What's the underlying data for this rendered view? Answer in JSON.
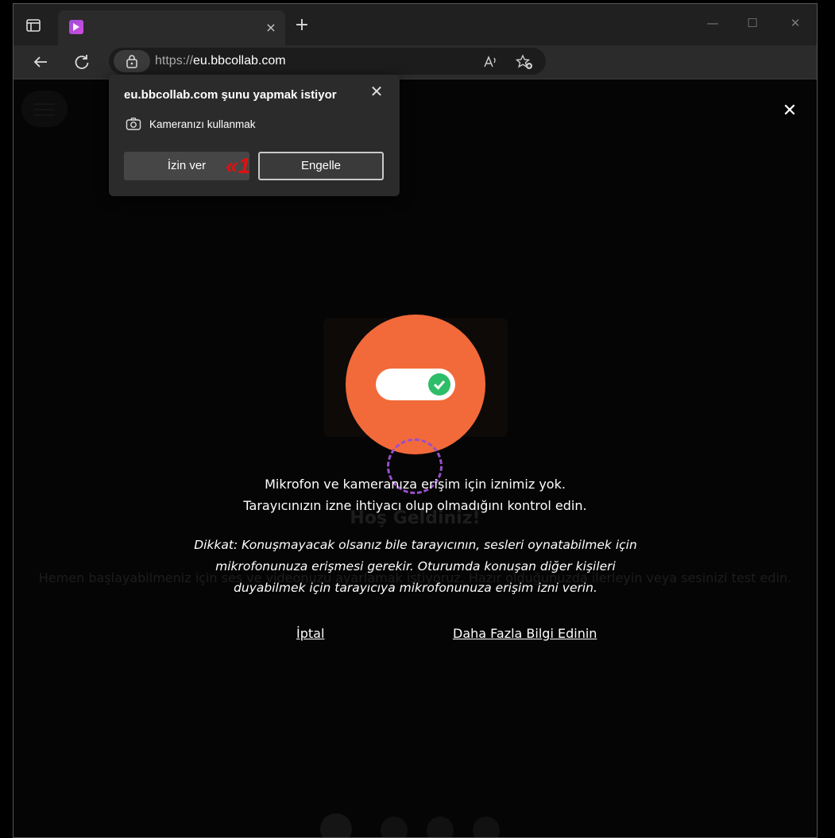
{
  "browser": {
    "url_scheme": "https://",
    "url_host": "eu.bbcollab.com",
    "new_tab_symbol": "+",
    "tab_close_symbol": "×",
    "minimize_symbol": "—",
    "maximize_symbol": "☐",
    "close_symbol": "✕"
  },
  "permission_popup": {
    "title": "eu.bbcollab.com şunu yapmak istiyor",
    "permission_label": "Kameranızı kullanmak",
    "allow_label": "İzin ver",
    "block_label": "Engelle",
    "close_symbol": "✕",
    "annotation_marker": "«1"
  },
  "page": {
    "close_symbol": "✕",
    "background_title": "Hoş Geldiniz!",
    "background_subtitle": "Hemen başlayabilmeniz için ses ve videonuzu ayarlamak istiyoruz. Hazır olduğunuzda ilerleyin veya sesinizi test edin.",
    "message_line1": "Mikrofon ve kameranıza erişim için iznimiz yok.",
    "message_line2": "Tarayıcınızın izne ihtiyacı olup olmadığını kontrol edin.",
    "note_line1": "Dikkat: Konuşmayacak olsanız bile tarayıcının, sesleri oynatabilmek için",
    "note_line2": "mikrofonunuza erişmesi gerekir. Oturumda konuşan diğer kişileri",
    "note_line3": "duyabilmek için tarayıcıya mikrofonunuza erişim izni verin.",
    "cancel_link": "İptal",
    "learn_more_link": "Daha Fazla Bilgi Edinin"
  },
  "colors": {
    "accent_orange": "#f26a3a",
    "toggle_check_green": "#2ebd68",
    "dashed_purple": "#9a4fc9",
    "marker_red": "#e01010"
  }
}
